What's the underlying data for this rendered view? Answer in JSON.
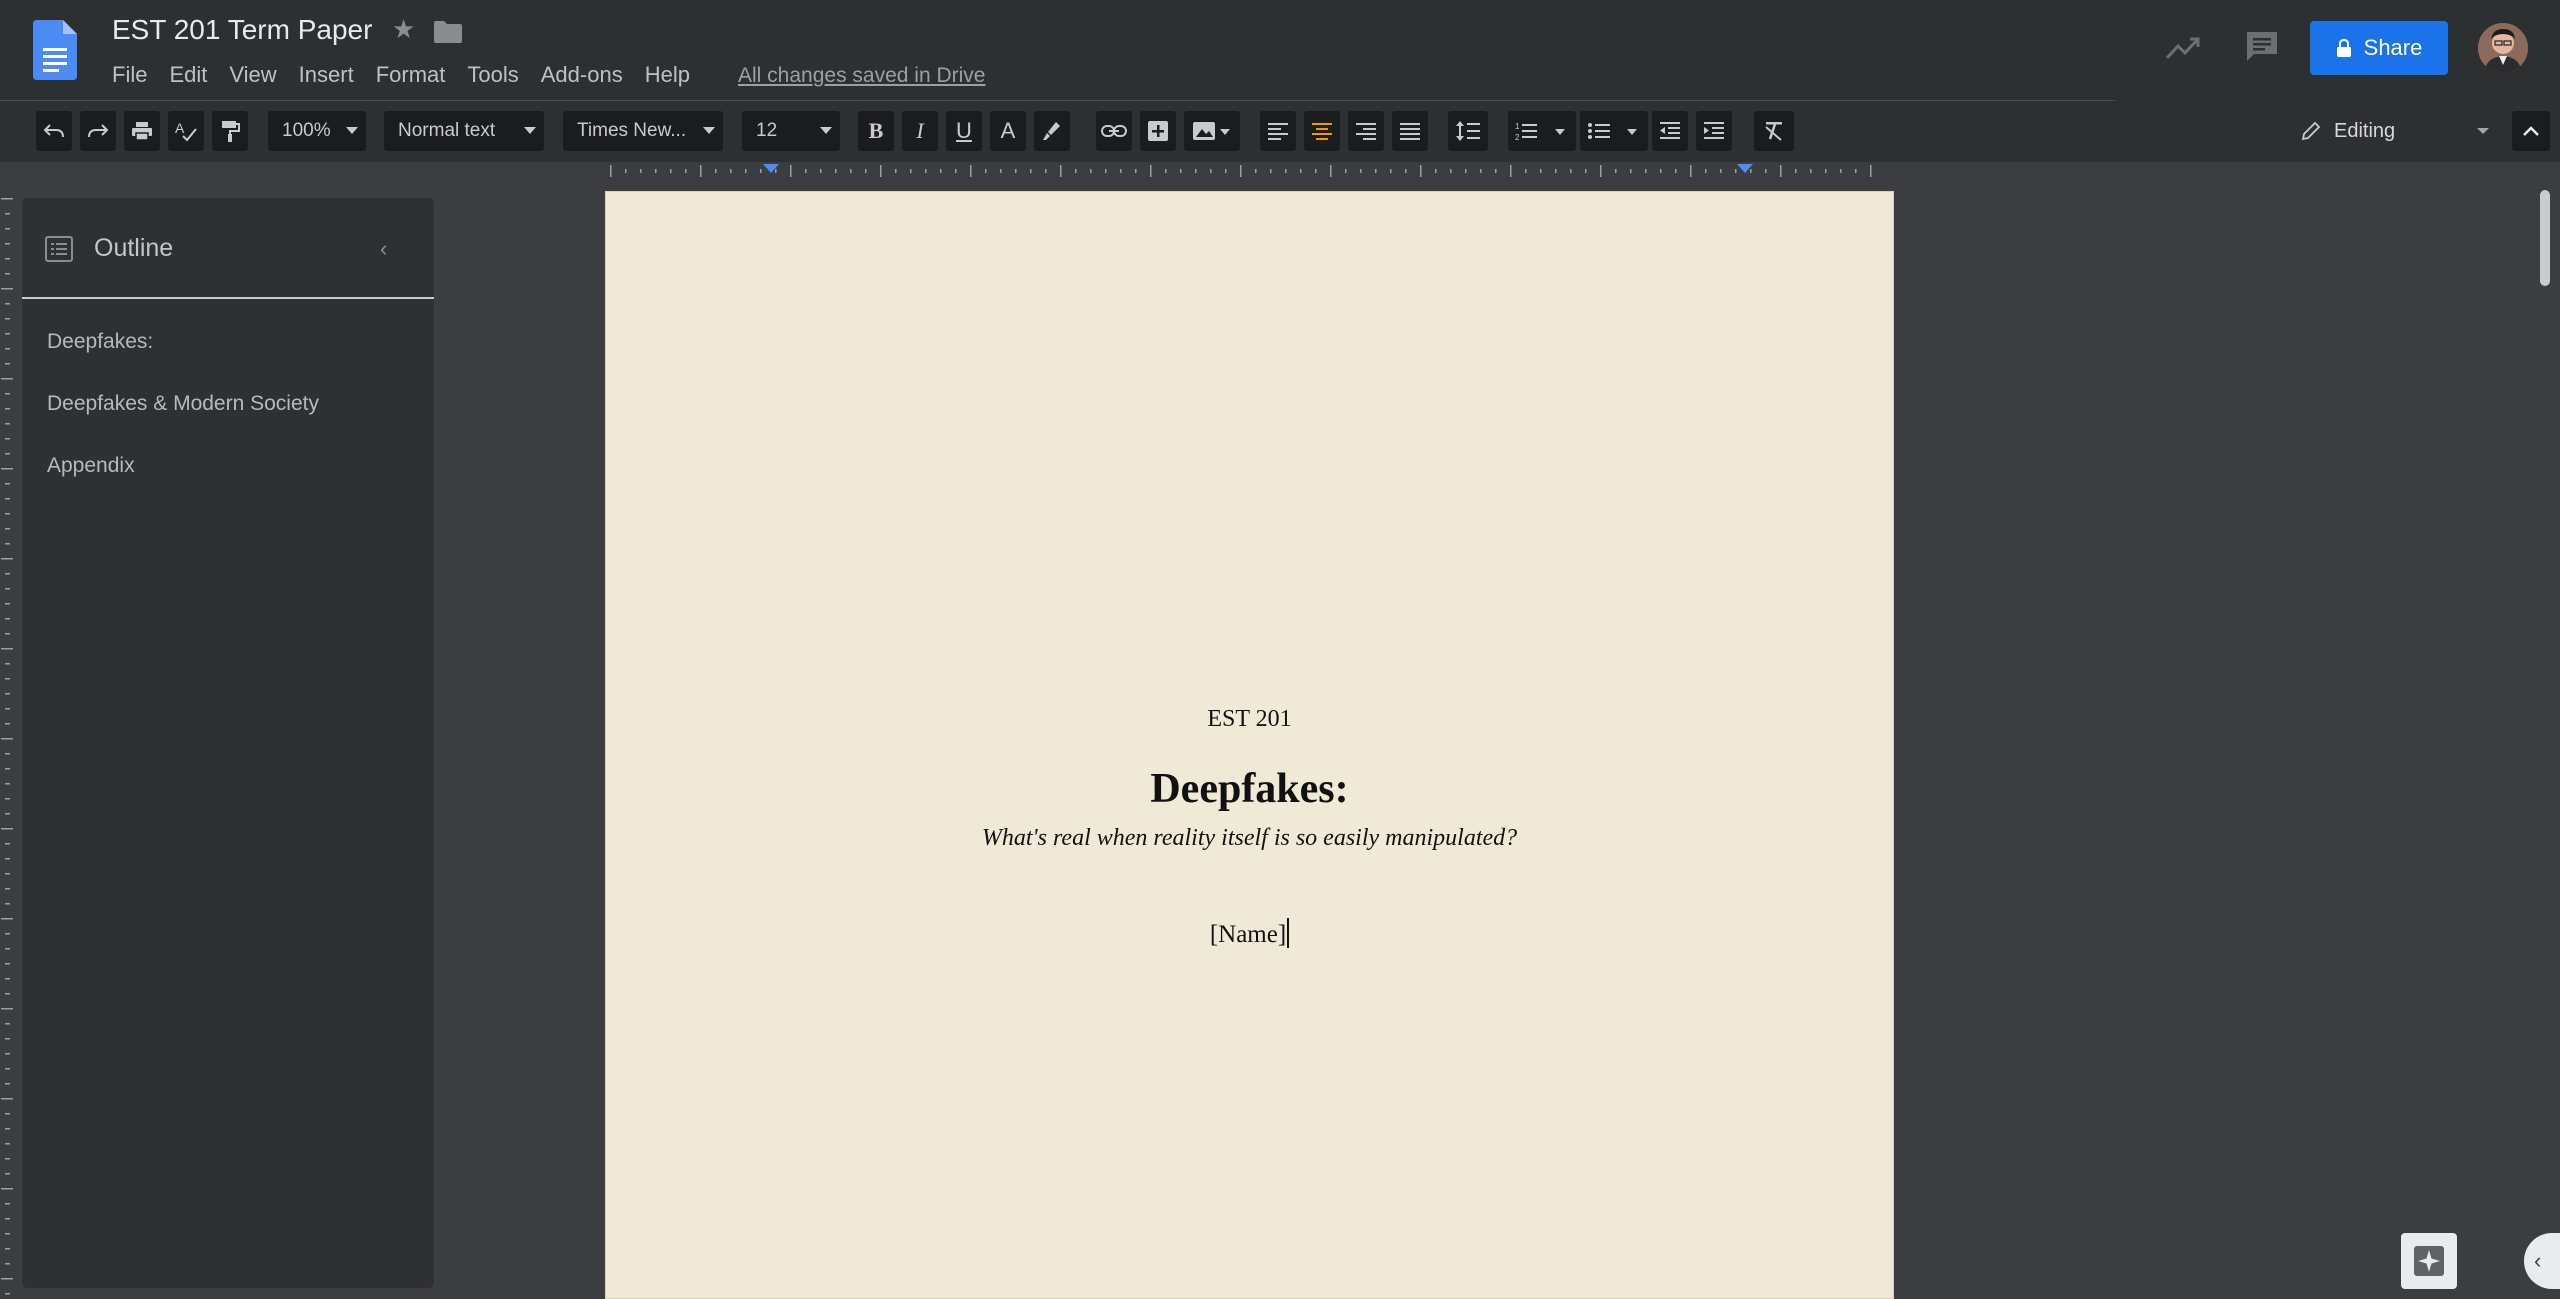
{
  "header": {
    "doc_title": "EST 201 Term Paper",
    "menu": [
      "File",
      "Edit",
      "View",
      "Insert",
      "Format",
      "Tools",
      "Add-ons",
      "Help"
    ],
    "saved_status": "All changes saved in Drive",
    "share_label": "Share"
  },
  "toolbar": {
    "zoom": "100%",
    "style": "Normal text",
    "font": "Times New...",
    "font_size": "12",
    "bold_label": "B",
    "italic_label": "I",
    "underline_label": "U",
    "text_color_label": "A",
    "editing_mode": "Editing"
  },
  "outline": {
    "title": "Outline",
    "items": [
      "Deepfakes:",
      "Deepfakes & Modern Society",
      "Appendix"
    ]
  },
  "document": {
    "course": "EST 201",
    "title": "Deepfakes:",
    "subtitle": "What's real when reality itself is so easily manipulated?",
    "name_placeholder": "[Name]"
  },
  "colors": {
    "accent": "#1a73e8",
    "page_background": "#f1e9d8",
    "app_background": "#3c3d40"
  }
}
